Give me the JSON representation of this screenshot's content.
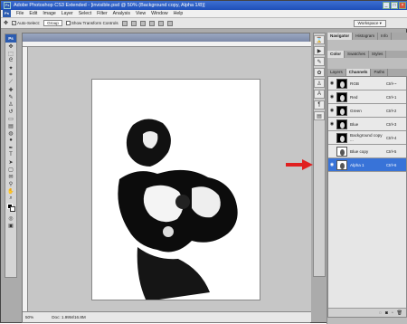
{
  "window": {
    "title": "Adobe Photoshop CS3 Extended - [invisible.psd @ 50% (Background copy, Alpha 1/8)]",
    "buttons": [
      "_",
      "□",
      "×"
    ]
  },
  "menu": {
    "items": [
      "File",
      "Edit",
      "Image",
      "Layer",
      "Select",
      "Filter",
      "Analysis",
      "View",
      "Window",
      "Help"
    ]
  },
  "options": {
    "auto_select_label": "Auto-Select:",
    "auto_select_value": "Group",
    "transform_label": "Show Transform Controls",
    "workspace_label": "Workspace ▾"
  },
  "document": {
    "title": "",
    "status_zoom": "50%",
    "status_doc": "Doc: 1.99M/16.8M"
  },
  "panels": {
    "top_tabs": [
      "Navigator",
      "Histogram",
      "Info"
    ],
    "mid_tabs": [
      "Color",
      "Swatches",
      "Styles"
    ],
    "main_tabs": [
      "Layers",
      "Channels",
      "Paths"
    ],
    "channels": [
      {
        "name": "RGB",
        "shortcut": "Ctrl+~",
        "thumb": "dark"
      },
      {
        "name": "Red",
        "shortcut": "Ctrl+1",
        "thumb": "dark"
      },
      {
        "name": "Green",
        "shortcut": "Ctrl+2",
        "thumb": "dark"
      },
      {
        "name": "Blue",
        "shortcut": "Ctrl+3",
        "thumb": "dark"
      },
      {
        "name": "Background copy ...",
        "shortcut": "Ctrl+4",
        "thumb": "dark"
      },
      {
        "name": "Blue copy",
        "shortcut": "Ctrl+5",
        "thumb": "white"
      },
      {
        "name": "Alpha 1",
        "shortcut": "Ctrl+6",
        "thumb": "white"
      }
    ]
  },
  "colors": {
    "accent": "#3873d8",
    "arrow": "#e02020"
  },
  "icons": {
    "eye": "eye-icon",
    "move": "move-tool-icon"
  }
}
